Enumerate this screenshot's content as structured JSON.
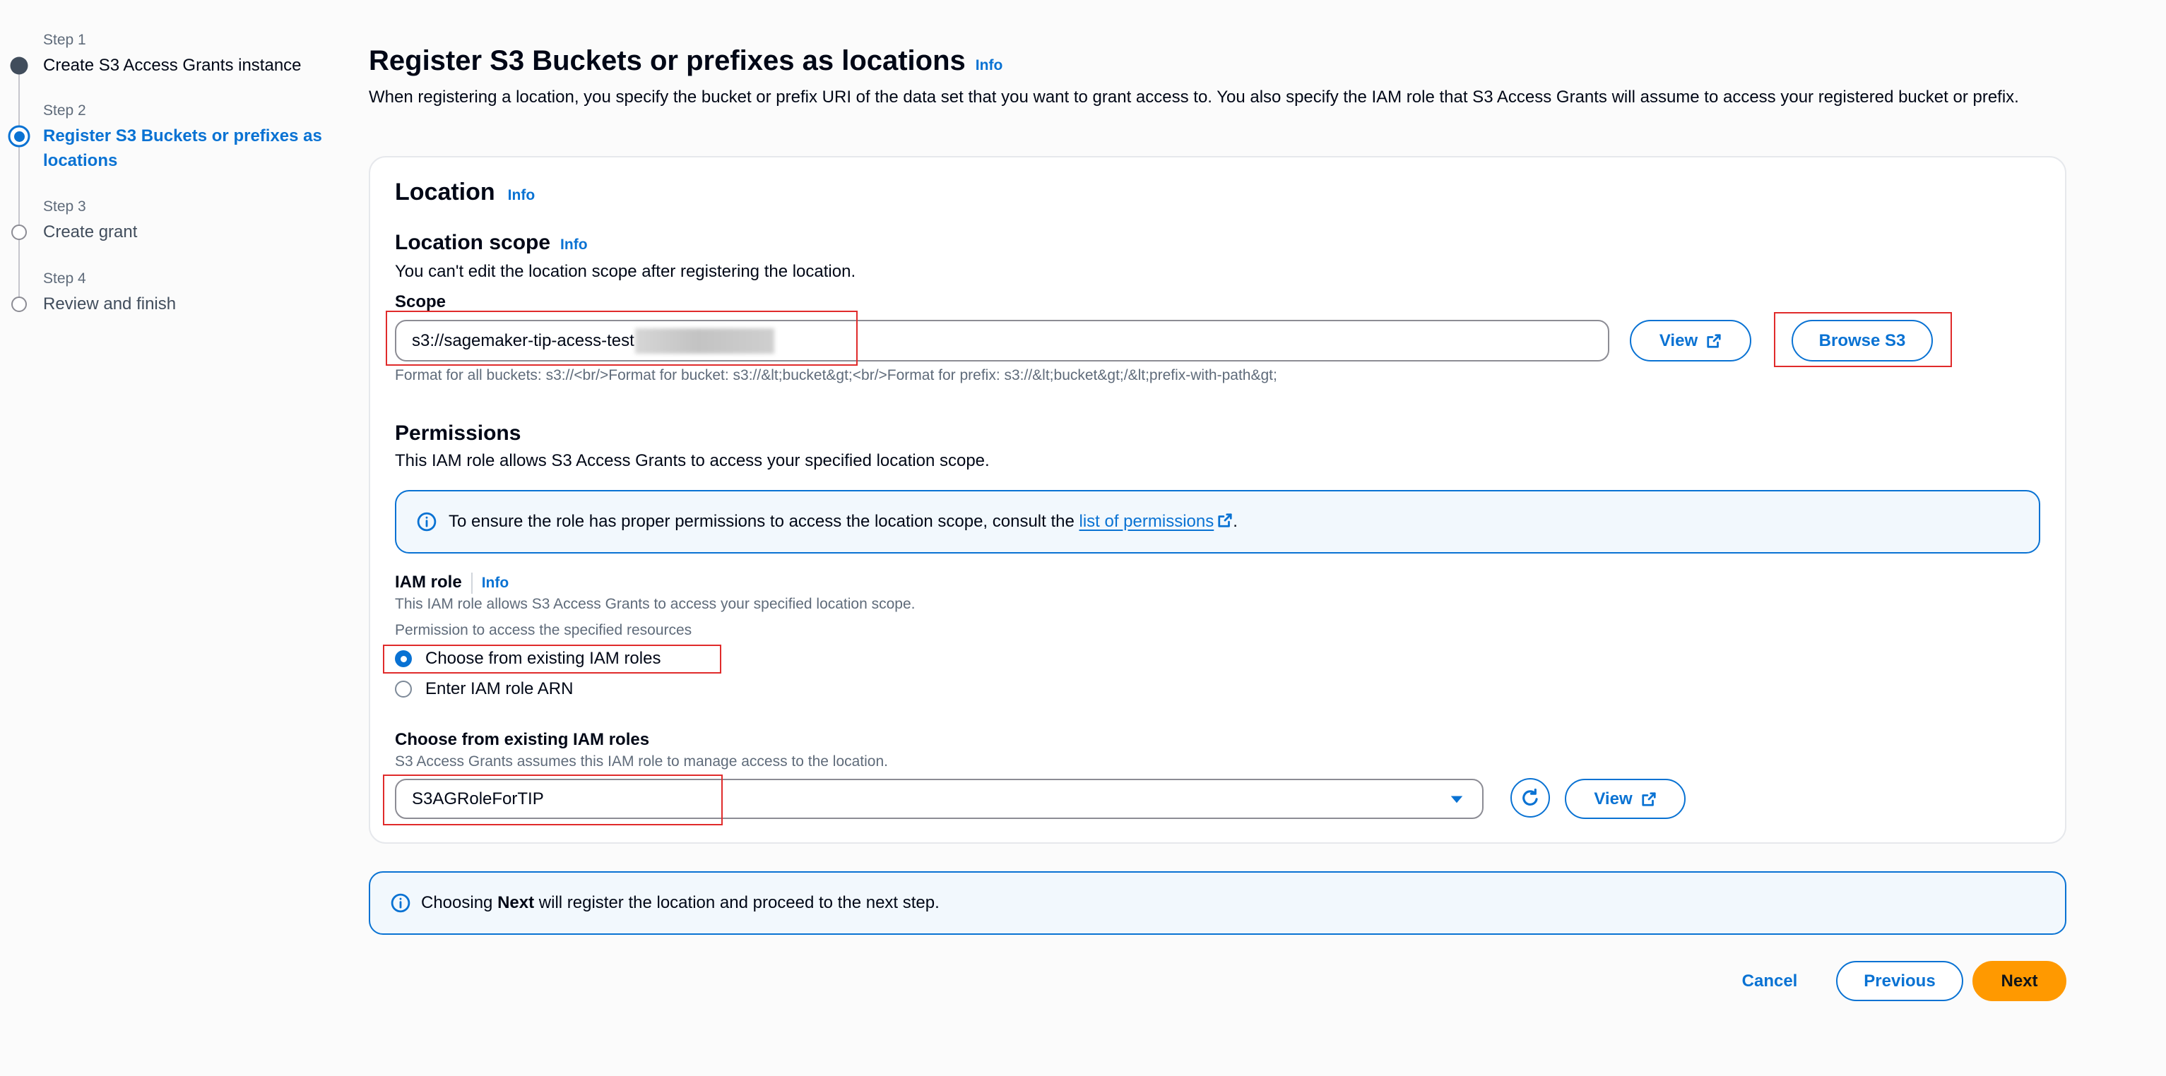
{
  "colors": {
    "accent": "#0972d3",
    "text": "#000716",
    "secondary_text": "#5f6b7a",
    "input_border": "#8c8c94",
    "alert_background": "#f2f8fd",
    "primary_button": "#ff9900",
    "annotation_box": "#e02b2b"
  },
  "icons": {
    "info": "info-circle-icon",
    "external_link": "external-link-icon",
    "refresh": "refresh-icon",
    "dropdown": "caret-down-icon"
  },
  "wizard": {
    "steps": [
      {
        "number_label": "Step 1",
        "title": "Create S3 Access Grants instance",
        "completed": true,
        "current": false
      },
      {
        "number_label": "Step 2",
        "title": "Register S3 Buckets or prefixes as locations",
        "completed": false,
        "current": true
      },
      {
        "number_label": "Step 3",
        "title": "Create grant",
        "completed": false,
        "current": false
      },
      {
        "number_label": "Step 4",
        "title": "Review and finish",
        "completed": false,
        "current": false
      }
    ]
  },
  "header": {
    "title": "Register S3 Buckets or prefixes as locations",
    "info": "Info",
    "description": "When registering a location, you specify the bucket or prefix URI of the data set that you want to grant access to. You also specify the IAM role that S3 Access Grants will assume to access your registered bucket or prefix."
  },
  "location": {
    "title": "Location",
    "info": "Info",
    "scope_section": {
      "title": "Location scope",
      "info": "Info",
      "description": "You can't edit the location scope after registering the location.",
      "field_label": "Scope",
      "value": "s3://sagemaker-tip-acess-test",
      "constraint_text": "Format for all buckets: s3://<br/>Format for bucket: s3://&lt;bucket&gt;<br/>Format for prefix: s3://&lt;bucket&gt;/&lt;prefix-with-path&gt;",
      "view_label": "View",
      "browse_label": "Browse S3"
    }
  },
  "permissions": {
    "title": "Permissions",
    "description": "This IAM role allows S3 Access Grants to access your specified location scope.",
    "alert": {
      "text_before": "To ensure the role has proper permissions to access the location scope, consult the ",
      "link_label": "list of permissions",
      "text_after": "."
    },
    "iam_role": {
      "label": "IAM role",
      "info": "Info",
      "description": "This IAM role allows S3 Access Grants to access your specified location scope.",
      "group_label": "Permission to access the specified resources",
      "options": [
        {
          "label": "Choose from existing IAM roles",
          "selected": true
        },
        {
          "label": "Enter IAM role ARN",
          "selected": false
        }
      ]
    },
    "existing_roles": {
      "label": "Choose from existing IAM roles",
      "description": "S3 Access Grants assumes this IAM role to manage access to the location.",
      "selected_value": "S3AGRoleForTIP",
      "view_label": "View"
    }
  },
  "footer_alert": {
    "text_before": "Choosing ",
    "emphasis": "Next",
    "text_after": " will register the location and proceed to the next step."
  },
  "actions": {
    "cancel_label": "Cancel",
    "previous_label": "Previous",
    "next_label": "Next"
  }
}
